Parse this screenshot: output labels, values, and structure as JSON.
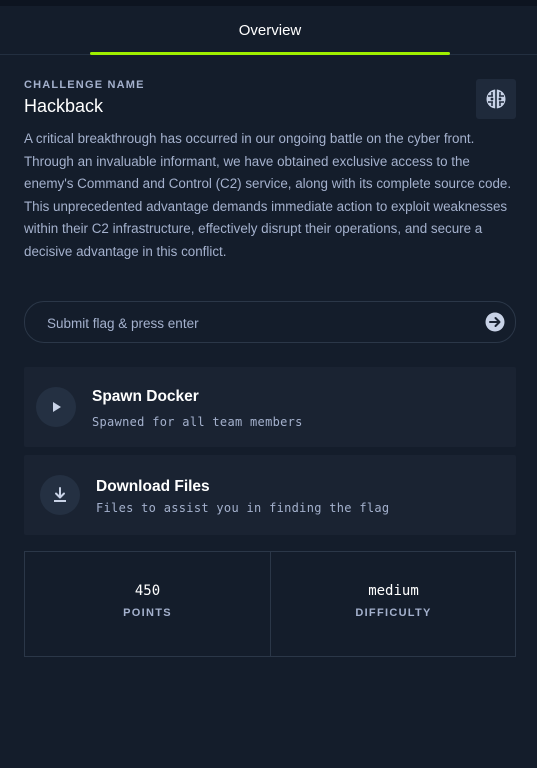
{
  "tabs": [
    {
      "label": "Overview",
      "active": true
    }
  ],
  "challenge": {
    "label": "CHALLENGE NAME",
    "name": "Hackback",
    "category_icon": "brain-icon",
    "description": "A critical breakthrough has occurred in our ongoing battle on the cyber front. Through an invaluable informant, we have obtained exclusive access to the enemy's Command and Control (C2) service, along with its complete source code. This unprecedented advantage demands immediate action to exploit weaknesses within their C2 infrastructure, effectively disrupt their operations, and secure a decisive advantage in this conflict."
  },
  "flag_input": {
    "value": "",
    "placeholder": "Submit flag & press enter",
    "submit_icon": "arrow-right-circle-icon"
  },
  "actions": {
    "spawn": {
      "title": "Spawn Docker",
      "subtitle": "Spawned for all team members",
      "icon": "play-icon"
    },
    "download": {
      "title": "Download Files",
      "subtitle": "Files to assist you in finding the flag",
      "icon": "download-icon"
    }
  },
  "stats": {
    "points": {
      "value": "450",
      "label": "POINTS"
    },
    "difficulty": {
      "value": "medium",
      "label": "DIFFICULTY"
    }
  },
  "colors": {
    "accent": "#9fef00",
    "background": "#141d2b",
    "card": "#1a2332",
    "muted_text": "#a4b1cd"
  }
}
